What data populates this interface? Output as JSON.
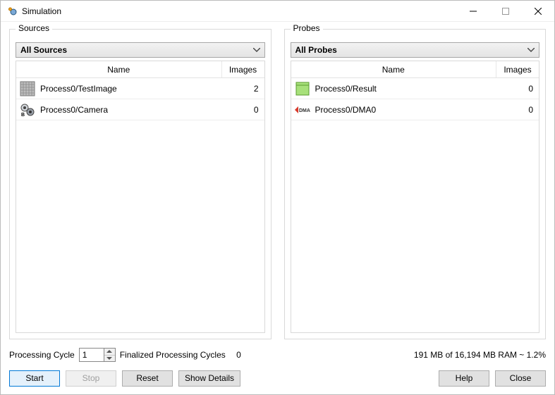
{
  "window": {
    "title": "Simulation"
  },
  "sources": {
    "legend": "Sources",
    "combo": "All Sources",
    "columns": {
      "name": "Name",
      "images": "Images"
    },
    "rows": [
      {
        "icon": "texture-icon",
        "name": "Process0/TestImage",
        "images": "2"
      },
      {
        "icon": "camera-icon",
        "name": "Process0/Camera",
        "images": "0"
      }
    ]
  },
  "probes": {
    "legend": "Probes",
    "combo": "All Probes",
    "columns": {
      "name": "Name",
      "images": "Images"
    },
    "rows": [
      {
        "icon": "result-icon",
        "name": "Process0/Result",
        "images": "0"
      },
      {
        "icon": "dma-icon",
        "name": "Process0/DMA0",
        "images": "0"
      }
    ]
  },
  "status": {
    "cycle_label": "Processing Cycle",
    "cycle_value": "1",
    "finalized_label": "Finalized Processing Cycles",
    "finalized_value": "0",
    "ram": "191 MB of 16,194 MB RAM ~ 1.2%"
  },
  "buttons": {
    "start": "Start",
    "stop": "Stop",
    "reset": "Reset",
    "showdetails": "Show Details",
    "help": "Help",
    "close": "Close"
  }
}
